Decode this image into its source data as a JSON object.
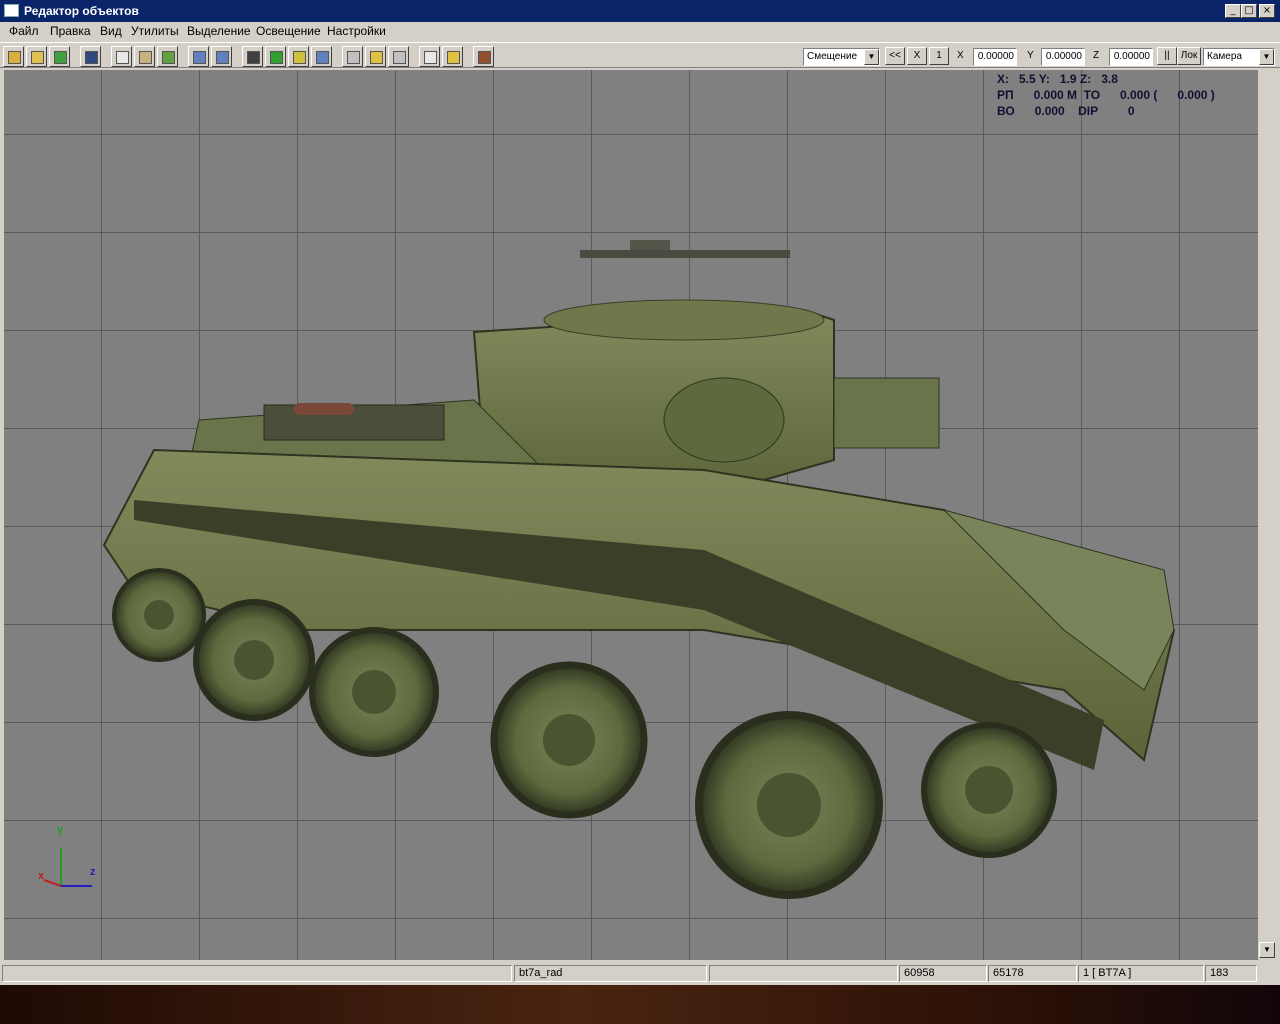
{
  "window": {
    "title": "Редактор объектов",
    "min": "_",
    "max": "□",
    "close": "×"
  },
  "menu": [
    "Файл",
    "Правка",
    "Вид",
    "Утилиты",
    "Выделение",
    "Освещение",
    "Настройки"
  ],
  "toolbar": {
    "mode_select": "Смещение",
    "btn_back": "<<",
    "btn_x": "X",
    "btn_one": "1",
    "x_label": "X",
    "x_value": "0.00000",
    "y_label": "Y",
    "y_value": "0.00000",
    "z_label": "Z",
    "z_value": "0.00000",
    "btn_pause": "||",
    "btn_lock": "Лок",
    "view_select": "Камера"
  },
  "readout": {
    "line1": "X:   5.5 Y:   1.9 Z:   3.8",
    "line2": "РП      0.000 М  ТО      0.000 (      0.000 )",
    "line3": "ВО      0.000    DIP         0"
  },
  "axes": {
    "y": "y",
    "x": "x",
    "z": "z"
  },
  "status": {
    "cell1": "",
    "cell2": "bt7a_rad",
    "cell3": "",
    "cell4": "60958",
    "cell5": "65178",
    "cell6": "1 [ BT7A ]",
    "cell7": "183"
  },
  "colors": {
    "titlebar": "#0a246a",
    "viewport": "#808080",
    "grid": "#5a5a5a",
    "tank": "#6b7448"
  }
}
